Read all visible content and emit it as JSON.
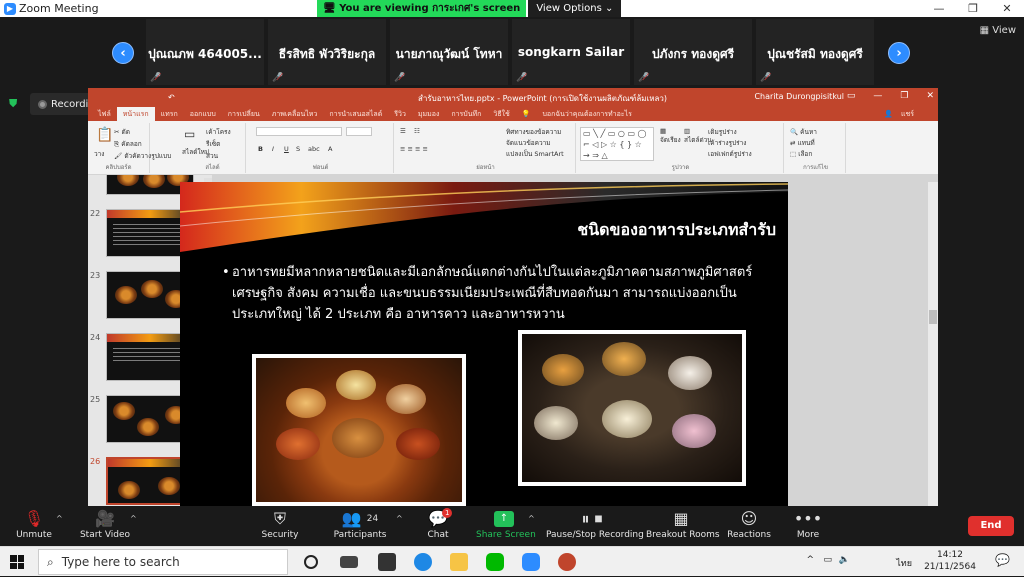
{
  "zoom": {
    "window_title": "Zoom Meeting",
    "share_banner_text": "You are viewing การะเกศ's screen",
    "view_options_label": "View Options",
    "view_label": "View",
    "recording_label": "Recording...",
    "participants": [
      {
        "name": "ปุณณภพ 464005..."
      },
      {
        "name": "ธีรสิทธิ พัววิริยะกุล"
      },
      {
        "name": "นายภาณุวัฒน์ โทหา"
      },
      {
        "name": "songkarn Sailar"
      },
      {
        "name": "ปภังกร ทองดูศรี"
      },
      {
        "name": "ปุณชรัสมิ ทองดูศรี"
      }
    ],
    "toolbar": {
      "unmute": "Unmute",
      "start_video": "Start Video",
      "security": "Security",
      "participants": "Participants",
      "participants_count": "24",
      "chat": "Chat",
      "chat_badge": "1",
      "share_screen": "Share Screen",
      "pause_recording": "Pause/Stop Recording",
      "breakout_rooms": "Breakout Rooms",
      "reactions": "Reactions",
      "more": "More",
      "end": "End"
    }
  },
  "ppt": {
    "file_title": "สำรับอาหารไทย.pptx - PowerPoint (การเปิดใช้งานผลิตภัณฑ์ล้มเหลว)",
    "user_name": "Charita Durongpisitkul",
    "share_label": "แชร์",
    "tabs": [
      "ไฟล์",
      "หน้าแรก",
      "แทรก",
      "ออกแบบ",
      "การเปลี่ยน",
      "ภาพเคลื่อนไหว",
      "การนำเสนอสไลด์",
      "รีวิว",
      "มุมมอง",
      "การบันทึก",
      "วิธีใช้",
      "บอกฉันว่าคุณต้องการทำอะไร"
    ],
    "ribbon": {
      "paste": "วาง",
      "cut": "ตัด",
      "copy": "คัดลอก",
      "format_painter": "ตัวคัดวางรูปแบบ",
      "clipboard_group": "คลิปบอร์ด",
      "new_slide": "สไลด์ใหม่",
      "layout": "เค้าโครง",
      "reset": "รีเซ็ต",
      "section": "ส่วน",
      "slides_group": "สไลด์",
      "font_group": "ฟอนต์",
      "paragraph_group": "ย่อหน้า",
      "text_direction": "ทิศทางของข้อความ",
      "align_text": "จัดแนวข้อความ",
      "convert_smartart": "แปลงเป็น SmartArt",
      "arrange": "จัดเรียง",
      "quick_styles": "สไตล์ด่วน",
      "shape_fill": "เติมรูปร่าง",
      "shape_outline": "เค้าร่างรูปร่าง",
      "shape_effects": "เอฟเฟกต์รูปร่าง",
      "drawing_group": "รูปวาด",
      "find": "ค้นหา",
      "replace": "แทนที่",
      "select": "เลือก",
      "editing_group": "การแก้ไข"
    },
    "thumbnails": [
      {
        "num": "",
        "kind": "food"
      },
      {
        "num": "22",
        "kind": "text"
      },
      {
        "num": "23",
        "kind": "food"
      },
      {
        "num": "24",
        "kind": "text"
      },
      {
        "num": "25",
        "kind": "food"
      },
      {
        "num": "26",
        "kind": "food",
        "selected": true
      }
    ],
    "slide": {
      "title": "ชนิดของอาหารประเภทสำรับ",
      "bullet_text": "อาหารทยมีหลากหลายชนิดและมีเอกลักษณ์แตกต่างกันไปในแต่ละภูมิภาคตามสภาพภูมิศาสตร์ เศรษฐกิจ สังคม ความเชื่อ และขนบธรรมเนียมประเพณีที่สืบทอดกันมา สามารถแบ่งออกเป็นประเภทใหญ่ ได้ 2 ประเภท คือ อาหารคาว และอาหารหวาน"
    }
  },
  "taskbar": {
    "search_placeholder": "Type here to search",
    "language": "ไทย",
    "time": "14:12",
    "date": "21/11/2564"
  }
}
